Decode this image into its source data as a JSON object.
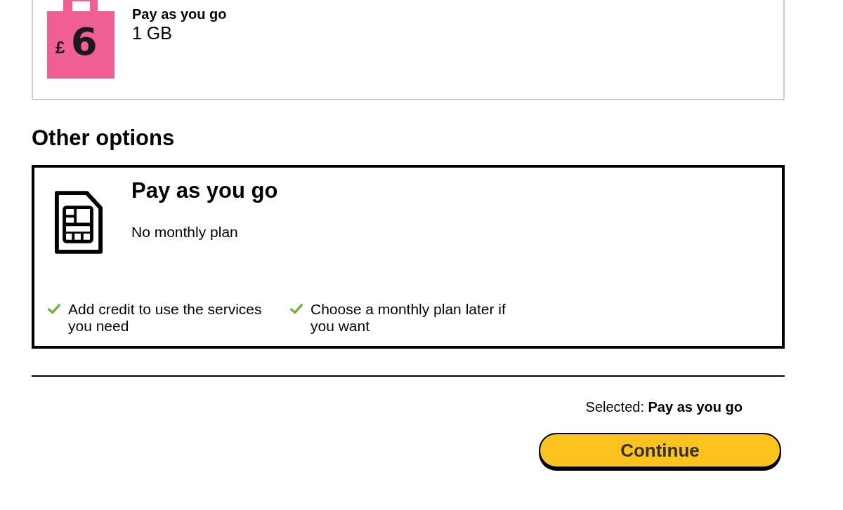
{
  "current_plan": {
    "price": {
      "currency": "£",
      "amount": "6"
    },
    "title": "Pay as you go",
    "allowance": "1 GB"
  },
  "other_options": {
    "heading": "Other options",
    "options": [
      {
        "title": "Pay as you go",
        "subtitle": "No monthly plan",
        "selected": true,
        "features": [
          "Add credit to use the services you need",
          "Choose a monthly plan later if you want"
        ]
      }
    ]
  },
  "summary": {
    "text": "Selected: **Pay as you go**"
  },
  "continue_button": {
    "label": "Continue"
  }
}
